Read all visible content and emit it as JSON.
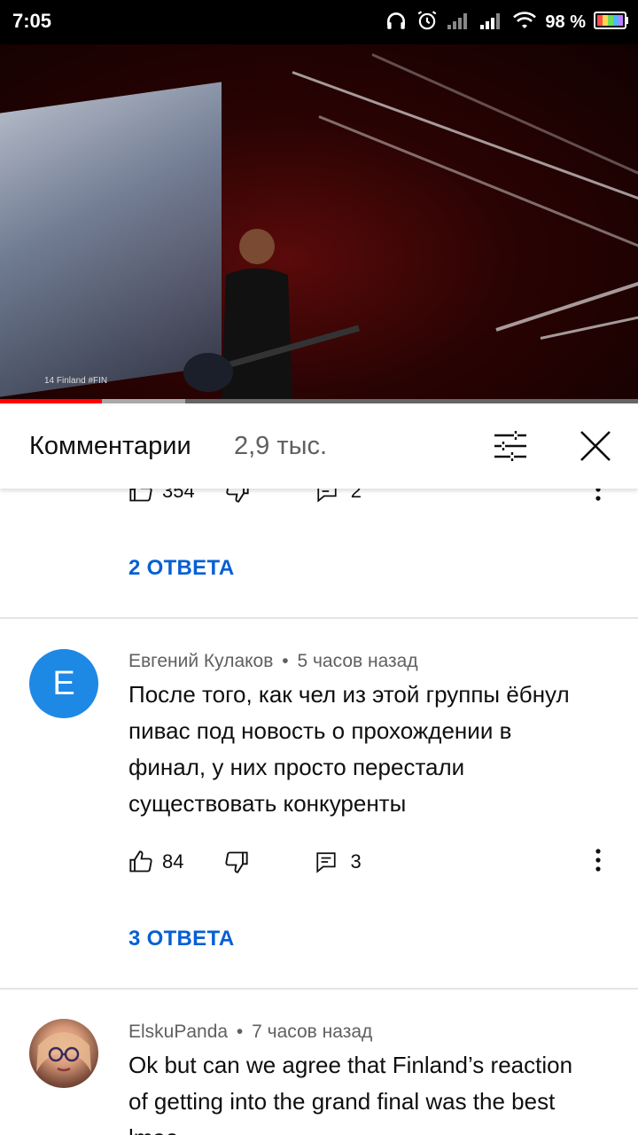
{
  "status_bar": {
    "time": "7:05",
    "battery_percent": "98 %"
  },
  "video": {
    "caption": "14 Finland #FIN",
    "progress": 0.16,
    "buffered": 0.29
  },
  "comments_header": {
    "title": "Комментарии",
    "count": "2,9 тыс."
  },
  "comments": [
    {
      "likes": "354",
      "reply_count": "2",
      "replies_label": "2 ОТВЕТА"
    },
    {
      "author": "Евгений Кулаков",
      "time": "5 часов назад",
      "avatar_letter": "E",
      "avatar_color": "#1e88e5",
      "text_lines": [
        "После того, как чел из этой группы ёбнул",
        "пивас под новость о прохождении в",
        "финал, у них просто перестали",
        "существовать конкуренты"
      ],
      "likes": "84",
      "reply_count": "3",
      "replies_label": "3 ОТВЕТА"
    },
    {
      "author": "ElskuPanda",
      "time": "7 часов назад",
      "text_lines": [
        "Ok but can we agree that Finland’s reaction",
        "of getting into the grand final was the best",
        "lmao"
      ]
    }
  ],
  "separator": "•",
  "accent_color": "#065fd4"
}
